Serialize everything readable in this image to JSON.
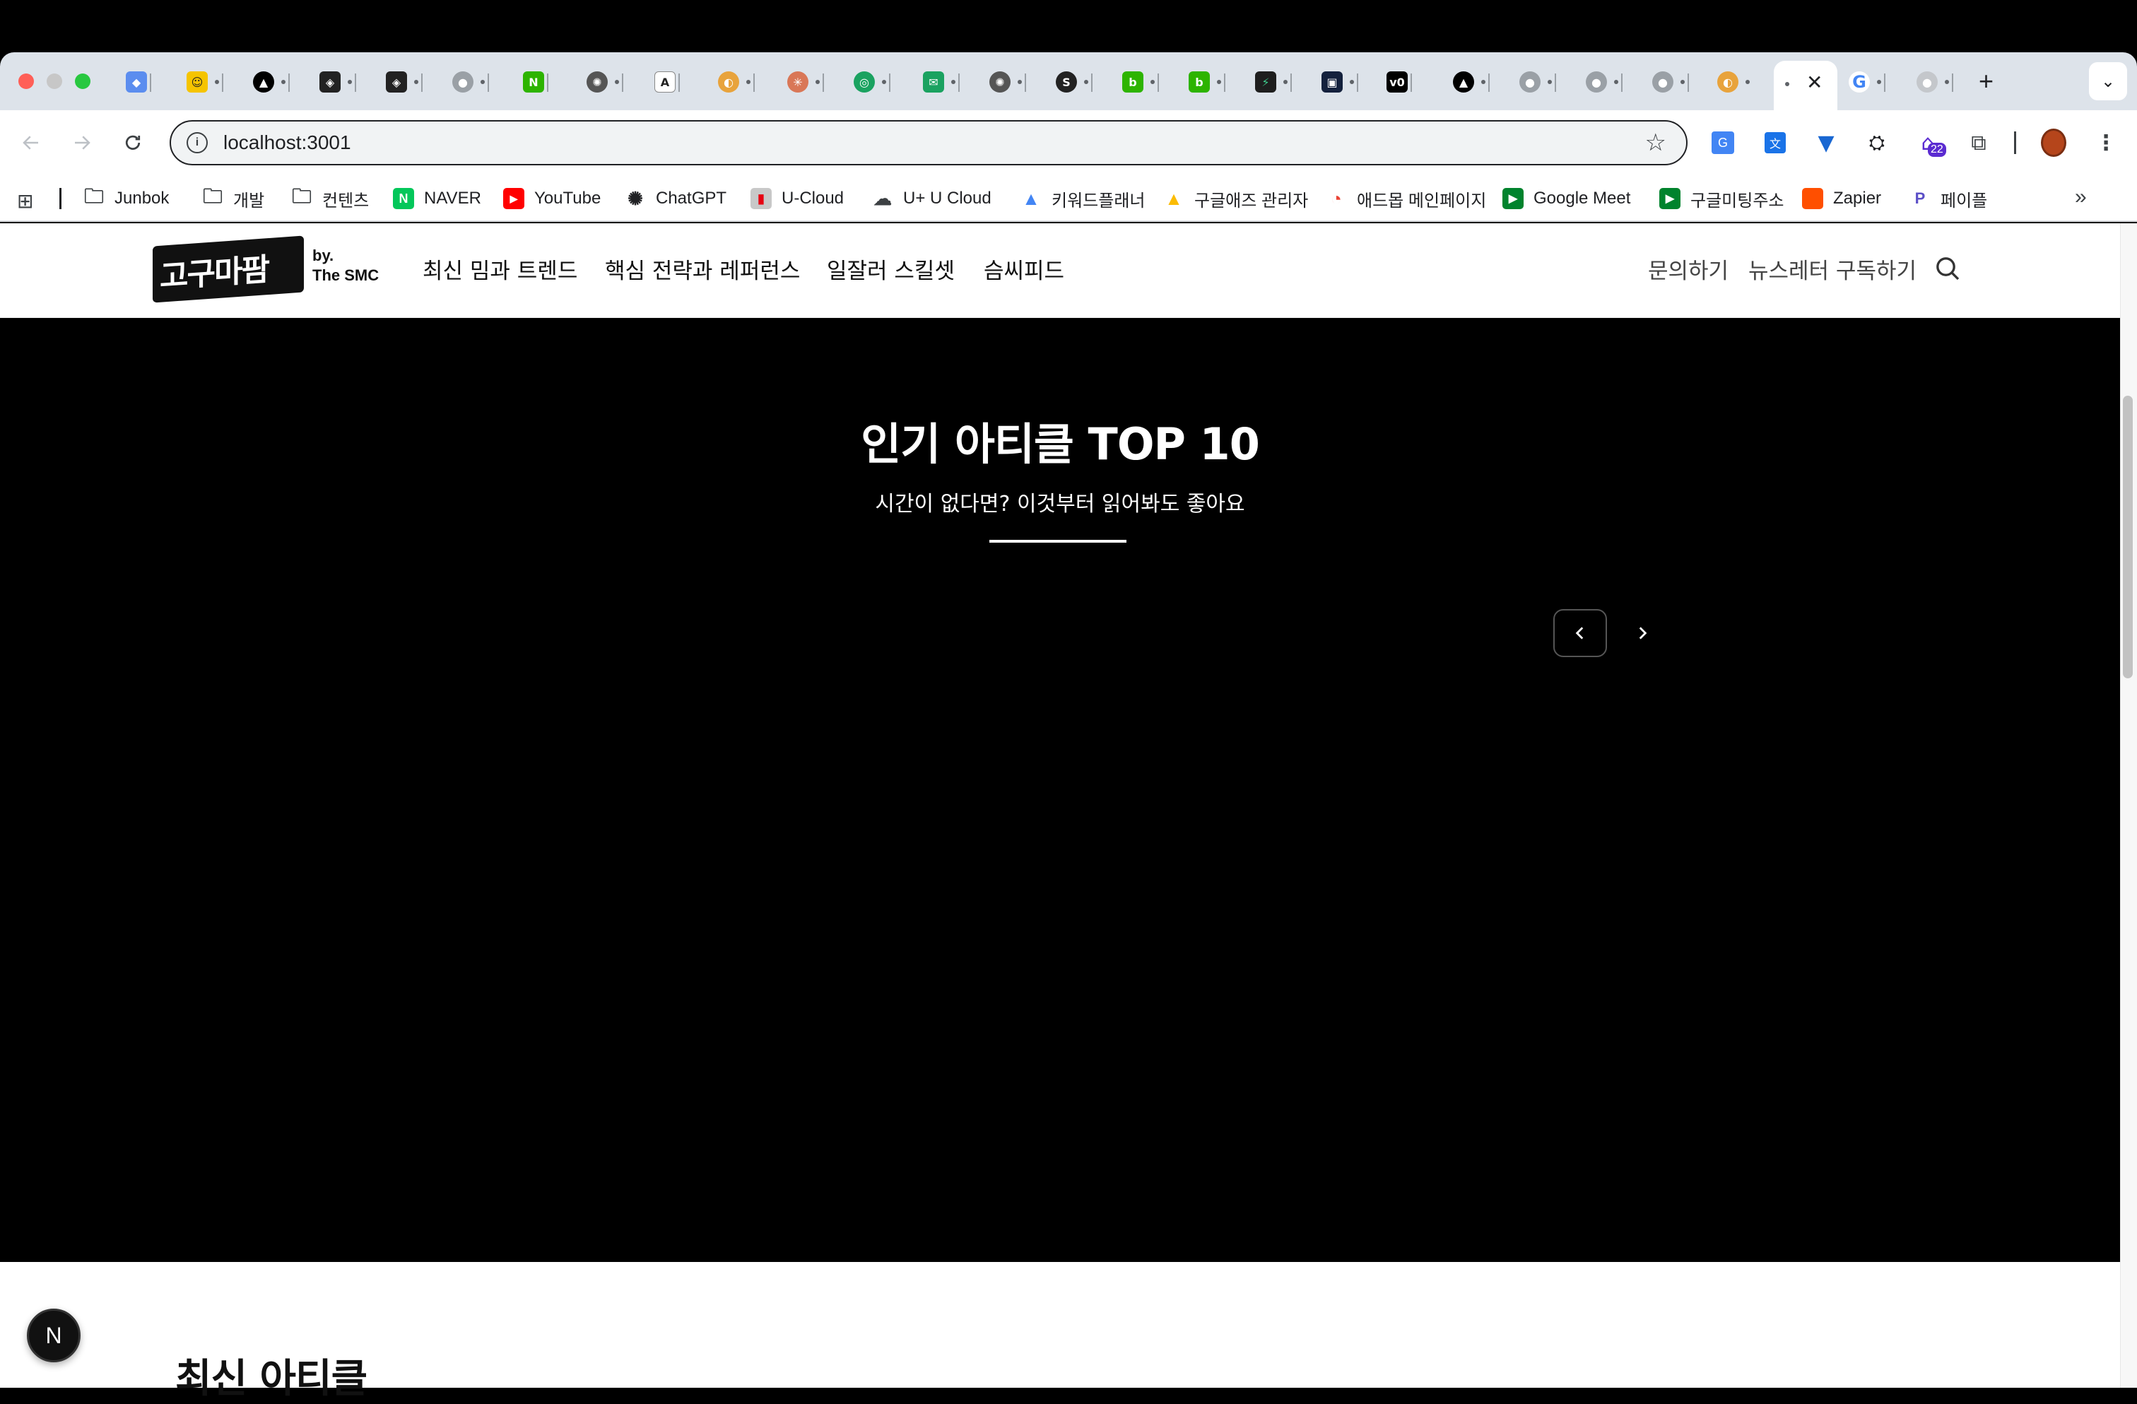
{
  "browser": {
    "url": "localhost:3001",
    "profile_badge": "22",
    "new_tab_symbol": "+"
  },
  "bookmarks": [
    {
      "label": "Junbok",
      "icon": "folder-icon"
    },
    {
      "label": "개발",
      "icon": "folder-icon"
    },
    {
      "label": "컨텐츠",
      "icon": "folder-icon"
    },
    {
      "label": "NAVER",
      "icon": "naver-icon",
      "color": "#03c75a"
    },
    {
      "label": "YouTube",
      "icon": "youtube-icon",
      "color": "#ff0000"
    },
    {
      "label": "ChatGPT",
      "icon": "chatgpt-icon"
    },
    {
      "label": "U-Cloud",
      "icon": "ucloud-icon"
    },
    {
      "label": "U+ U Cloud",
      "icon": "cloud-icon"
    },
    {
      "label": "키워드플래너",
      "icon": "google-ads-icon"
    },
    {
      "label": "구글애즈 관리자",
      "icon": "google-ads-icon"
    },
    {
      "label": "애드몹 메인페이지",
      "icon": "admob-icon"
    },
    {
      "label": "Google Meet",
      "icon": "google-meet-icon"
    },
    {
      "label": "구글미팅주소",
      "icon": "google-meet-icon"
    },
    {
      "label": "Zapier",
      "icon": "zapier-icon",
      "color": "#ff4f00"
    },
    {
      "label": "페이플",
      "icon": "payple-icon"
    }
  ],
  "site": {
    "logo_text": "고구마팜",
    "byline_1": "by.",
    "byline_2": "The SMC",
    "nav": [
      "최신 밈과 트렌드",
      "핵심 전략과 레퍼런스",
      "일잘러 스킬셋",
      "슴씨피드"
    ],
    "contact": "문의하기",
    "newsletter": "뉴스레터 구독하기"
  },
  "hero": {
    "title": "인기 아티클 TOP 10",
    "subtitle": "시간이 없다면? 이것부터 읽어봐도 좋아요"
  },
  "latest": {
    "title": "최신 아티클"
  },
  "dev_badge": "N",
  "colors": {
    "accent": "#000000",
    "tabstrip": "#dde3ea"
  }
}
